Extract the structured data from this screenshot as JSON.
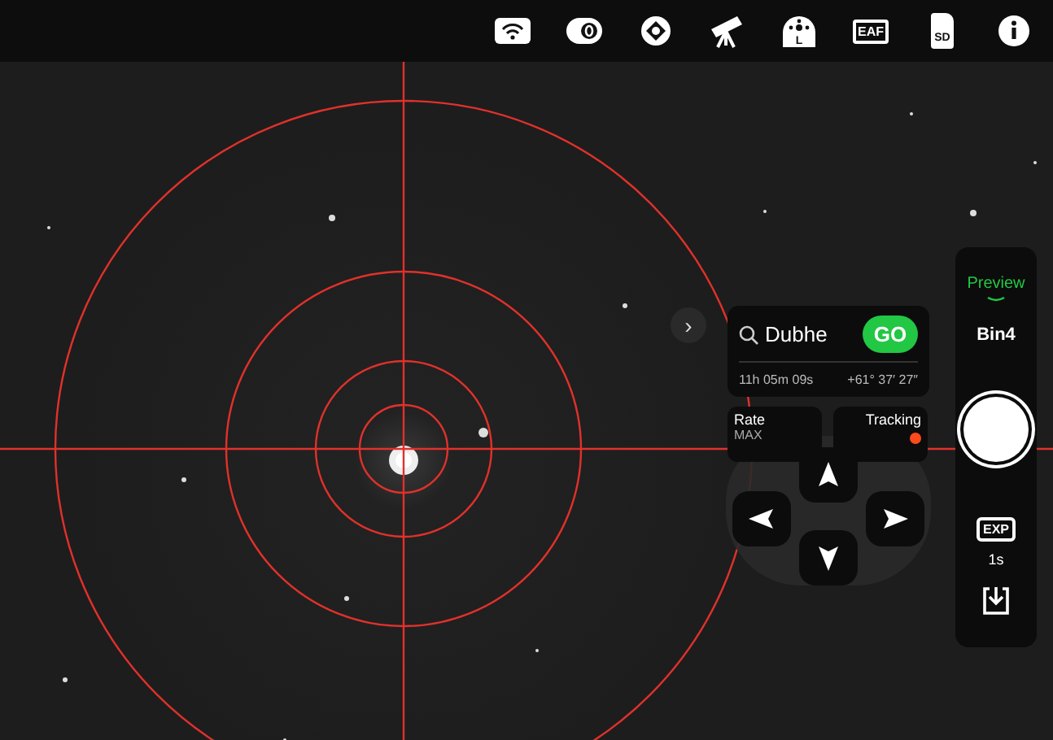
{
  "toolbar": {
    "items": [
      {
        "kind": "wifi"
      },
      {
        "kind": "camera"
      },
      {
        "kind": "focuser"
      },
      {
        "kind": "telescope"
      },
      {
        "kind": "mount",
        "label": "L"
      },
      {
        "kind": "eaf",
        "label": "EAF"
      },
      {
        "kind": "sd",
        "label": "SD"
      },
      {
        "kind": "info"
      }
    ]
  },
  "viewer": {
    "expand": "›"
  },
  "goto": {
    "target": "Dubhe",
    "go": "GO",
    "ra": "11h 05m 09s",
    "dec": "+61° 37′ 27″"
  },
  "rate": {
    "label": "Rate",
    "value": "MAX"
  },
  "tracking": {
    "label": "Tracking",
    "on": true
  },
  "capture": {
    "mode": "Preview",
    "bin": "Bin4",
    "exposure_label": "EXP",
    "exposure": "1s"
  }
}
